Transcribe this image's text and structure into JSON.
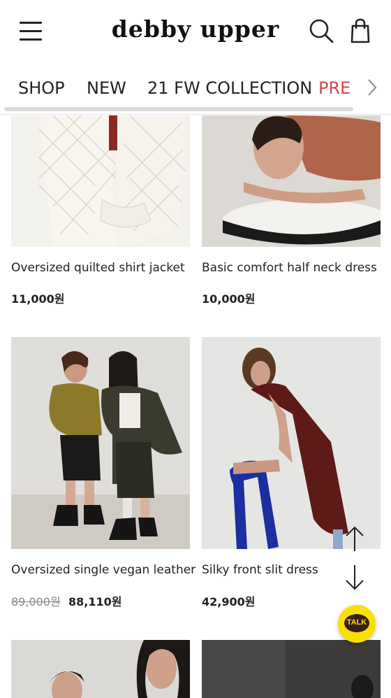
{
  "header": {
    "logo": "debby upper"
  },
  "nav": {
    "tabs": [
      {
        "label": "SHOP"
      },
      {
        "label": "NEW"
      },
      {
        "label": "21 FW COLLECTION"
      },
      {
        "label": "PRE"
      }
    ]
  },
  "products": [
    {
      "name": "Oversized quilted shirt jacket",
      "price": "11,000원"
    },
    {
      "name": "Basic comfort half neck dress",
      "price": "10,000원"
    },
    {
      "name": "Oversized single vegan leather",
      "old_price": "89,000원",
      "price": "88,110원"
    },
    {
      "name": "Silky front slit dress",
      "price": "42,900원"
    }
  ],
  "floating": {
    "talk_label": "TALK"
  },
  "colors": {
    "accent": "#d04848",
    "talk_bg": "#f9e000",
    "talk_bubble": "#3a1d1d"
  }
}
